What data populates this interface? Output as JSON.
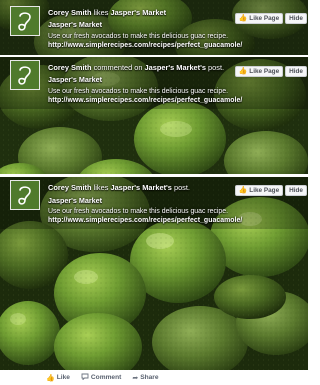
{
  "colors": {
    "logo_green": "#4f7a2c",
    "avocado": "#5e8f2e",
    "avocado_dark": "#2a3d14",
    "button_bg": "#f5f6f7"
  },
  "posts": [
    {
      "headline_actor": "Corey Smith",
      "headline_verb": " likes ",
      "headline_target": "Jasper's Market",
      "headline_tail": "",
      "page_name": "Jasper's Market",
      "body_text": "Use our fresh avocados to make this delicious guac recipe.",
      "url": "http://www.simplerecipes.com/recipes/perfect_guacamole/",
      "like_page_label": "Like Page",
      "hide_label": "Hide",
      "logo_icon": "script-j-logo-icon",
      "image_icon": "avocados-photo"
    },
    {
      "headline_actor": "Corey Smith",
      "headline_verb": " commented on ",
      "headline_target": "Jasper's Market's",
      "headline_tail": " post.",
      "page_name": "Jasper's Market",
      "body_text": "Use our fresh avocados to make this delicious guac recipe.",
      "url": "http://www.simplerecipes.com/recipes/perfect_guacamole/",
      "like_page_label": "Like Page",
      "hide_label": "Hide",
      "logo_icon": "script-j-logo-icon",
      "image_icon": "avocados-photo"
    },
    {
      "headline_actor": "Corey Smith",
      "headline_verb": " likes ",
      "headline_target": "Jasper's Market's",
      "headline_tail": " post.",
      "page_name": "Jasper's Market",
      "body_text": "Use our fresh avocados to make this delicious guac recipe.",
      "url": "http://www.simplerecipes.com/recipes/perfect_guacamole/",
      "like_page_label": "Like Page",
      "hide_label": "Hide",
      "logo_icon": "script-j-logo-icon",
      "image_icon": "avocados-photo"
    }
  ],
  "actions": {
    "like": "Like",
    "comment": "Comment",
    "share": "Share"
  }
}
